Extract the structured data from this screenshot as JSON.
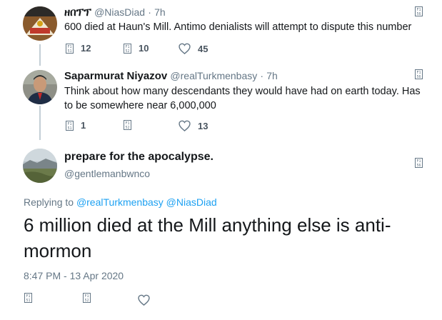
{
  "tweets": [
    {
      "name": "ዘበፕፕ",
      "handle": "@NiasDiad",
      "time": "7h",
      "text": "600 died at Haun's Mill. Antimo denialists will attempt to dispute this number",
      "reply_count": "12",
      "retweet_count": "10",
      "like_count": "45"
    },
    {
      "name": "Saparmurat Niyazov",
      "handle": "@realTurkmenbasy",
      "time": "7h",
      "text": "Think about how many descendants they would have had on earth today. Has to be somewhere near 6,000,000",
      "reply_count": "1",
      "retweet_count": "",
      "like_count": "13"
    }
  ],
  "main": {
    "name": "prepare for the apocalypse.",
    "handle": "@gentlemanbwnco",
    "replying_prefix": "Replying to",
    "replying_to_1": "@realTurkmenbasy",
    "replying_to_2": "@NiasDiad",
    "text": "6 million died at the Mill anything else is anti-mormon",
    "timestamp": "8:47 PM - 13 Apr 2020"
  },
  "glyph": {
    "reply_icon": "F1\n51",
    "retweet_icon": "F1\n52",
    "caret_icon": "F1\n56"
  },
  "colors": {
    "text": "#14171a",
    "muted": "#657786",
    "link": "#1da1f2",
    "thread_line": "#c4cfd6"
  }
}
